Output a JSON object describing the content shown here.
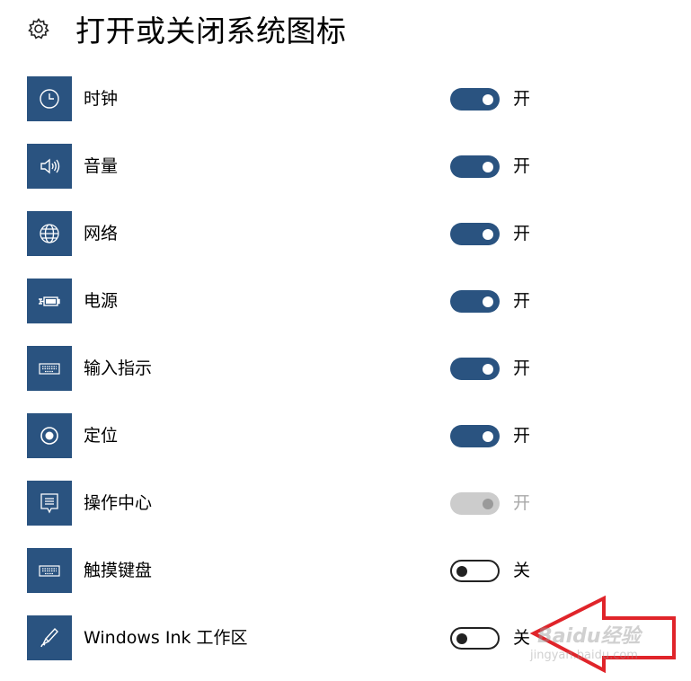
{
  "header": {
    "title": "打开或关闭系统图标",
    "icon": "gear-icon"
  },
  "items": [
    {
      "id": "clock",
      "icon": "clock-icon",
      "label": "时钟",
      "state": "开",
      "toggle": "on"
    },
    {
      "id": "volume",
      "icon": "speaker-icon",
      "label": "音量",
      "state": "开",
      "toggle": "on"
    },
    {
      "id": "network",
      "icon": "globe-icon",
      "label": "网络",
      "state": "开",
      "toggle": "on"
    },
    {
      "id": "power",
      "icon": "battery-icon",
      "label": "电源",
      "state": "开",
      "toggle": "on"
    },
    {
      "id": "input-indicator",
      "icon": "keyboard-icon",
      "label": "输入指示",
      "state": "开",
      "toggle": "on"
    },
    {
      "id": "location",
      "icon": "location-icon",
      "label": "定位",
      "state": "开",
      "toggle": "on"
    },
    {
      "id": "action-center",
      "icon": "action-center-icon",
      "label": "操作中心",
      "state": "开",
      "toggle": "disabled"
    },
    {
      "id": "touch-keyboard",
      "icon": "keyboard-icon",
      "label": "触摸键盘",
      "state": "关",
      "toggle": "off"
    },
    {
      "id": "windows-ink",
      "icon": "pen-icon",
      "label": "Windows Ink 工作区",
      "state": "关",
      "toggle": "off"
    }
  ],
  "colors": {
    "accent": "#2a5380",
    "annotation": "#e0242a"
  },
  "watermark": {
    "text": "Baidu经验",
    "subtext": "jingyan.baidu.com"
  }
}
